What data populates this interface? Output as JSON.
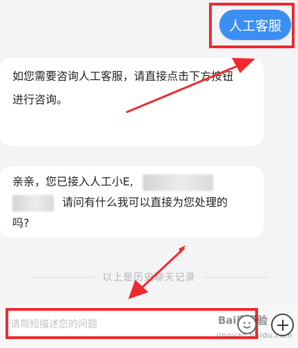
{
  "header": {
    "cs_button_label": "人工客服"
  },
  "messages": [
    {
      "lines": [
        "如您需要咨询人工客服，请直接点击下方按钮",
        "进行咨询。"
      ]
    },
    {
      "line1": "亲亲，您已接入人工小E,",
      "line2": "请问有什么我可以直接为您处理的",
      "line3": "吗?"
    }
  ],
  "history_label": "以上是历史聊天记录",
  "composer": {
    "placeholder": "请简短描述您的问题"
  },
  "watermark": {
    "brand": "Bai度经验",
    "sub": "jingyan.baidu.com"
  },
  "colors": {
    "accent": "#3b8ff2",
    "annotation": "#f0292f",
    "background": "#f4f4f6",
    "bubble": "#ffffff"
  },
  "icons": {
    "emoji": "emoji-icon",
    "plus": "plus-icon"
  }
}
